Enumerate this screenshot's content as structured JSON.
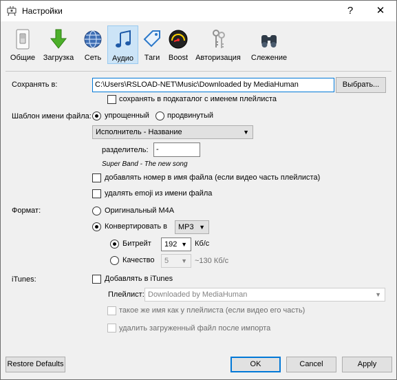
{
  "window": {
    "title": "Настройки",
    "help_glyph": "?",
    "close_glyph": "✕"
  },
  "toolbar": {
    "items": [
      {
        "label": "Общие",
        "icon": "switch-icon"
      },
      {
        "label": "Загрузка",
        "icon": "download-arrow-icon"
      },
      {
        "label": "Сеть",
        "icon": "globe-icon"
      },
      {
        "label": "Аудио",
        "icon": "music-note-icon",
        "active": true
      },
      {
        "label": "Таги",
        "icon": "tag-icon"
      },
      {
        "label": "Boost",
        "icon": "speedometer-icon"
      },
      {
        "label": "Авторизация",
        "icon": "keys-icon"
      },
      {
        "label": "Слежение",
        "icon": "binoculars-icon"
      }
    ]
  },
  "save": {
    "label": "Сохранять в:",
    "path": "C:\\Users\\RSLOAD-NET\\Music\\Downloaded by MediaHuman",
    "browse_label": "Выбрать...",
    "subfolder_label": "сохранять в подкаталог с именем плейлиста"
  },
  "template": {
    "label": "Шаблон имени файла:",
    "simple_label": "упрощенный",
    "advanced_label": "продвинутый",
    "pattern_value": "Исполнитель - Название",
    "separator_label": "разделитель:",
    "separator_value": "-",
    "example": "Super Band - The new song",
    "add_number_label": "добавлять номер в имя файла (если видео часть плейлиста)",
    "remove_emoji_label": "удалять emoji из имени файла"
  },
  "format": {
    "label": "Формат:",
    "original_label": "Оригинальный M4A",
    "convert_label": "Конвертировать в",
    "convert_value": "MP3",
    "bitrate_label": "Битрейт",
    "bitrate_value": "192",
    "bitrate_unit": "Кб/с",
    "quality_label": "Качество",
    "quality_value": "5",
    "quality_hint": "~130 Кб/с"
  },
  "itunes": {
    "label": "iTunes:",
    "add_label": "Добавлять в iTunes",
    "playlist_label": "Плейлист:",
    "playlist_value": "Downloaded by MediaHuman",
    "same_name_label": "такое же имя как у плейлиста (если видео его часть)",
    "delete_after_label": "удалить загруженный файл после импорта"
  },
  "footer": {
    "restore_label": "Restore Defaults",
    "ok_label": "OK",
    "cancel_label": "Cancel",
    "apply_label": "Apply"
  },
  "colors": {
    "accent": "#0078d7",
    "window_bg": "#f0f0f0",
    "active_tab": "#cce4f7"
  }
}
